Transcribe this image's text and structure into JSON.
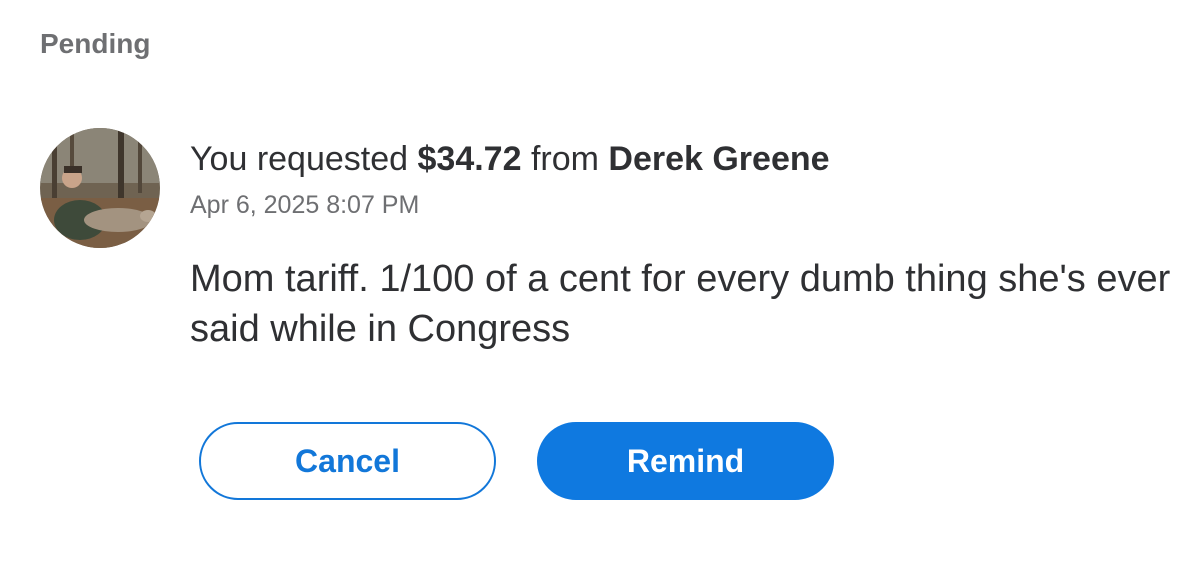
{
  "section": {
    "header": "Pending"
  },
  "request": {
    "prefix": "You requested",
    "amount": "$34.72",
    "connector": "from",
    "counterparty": "Derek Greene",
    "timestamp": "Apr 6, 2025 8:07 PM",
    "note": "Mom tariff. 1/100 of a cent for every dumb thing she's ever said while in Congress"
  },
  "actions": {
    "cancel_label": "Cancel",
    "remind_label": "Remind"
  },
  "colors": {
    "accent": "#0f79e0",
    "text_primary": "#2f3033",
    "text_secondary": "#6e6f72"
  }
}
